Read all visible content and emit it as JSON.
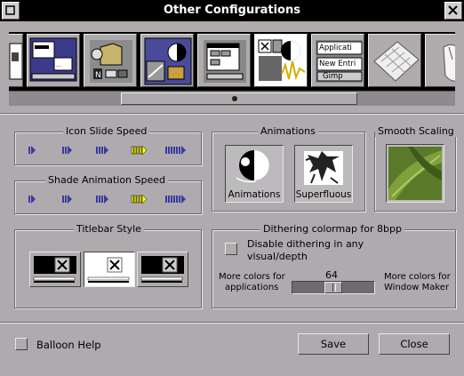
{
  "window": {
    "title": "Other Configurations"
  },
  "tabs": [
    {
      "id": "icon-prefs"
    },
    {
      "id": "workspace-prefs"
    },
    {
      "id": "misc-prefs"
    },
    {
      "id": "theme-prefs"
    },
    {
      "id": "window-handling"
    },
    {
      "id": "other-configurations",
      "selected": true
    },
    {
      "id": "application-prefs",
      "labels": [
        "Applicati",
        "New Entri",
        "Gimp"
      ]
    },
    {
      "id": "keyboard-prefs"
    },
    {
      "id": "mouse-prefs"
    }
  ],
  "icon_slide": {
    "title": "Icon Slide Speed",
    "levels": 5,
    "selected_index": 3
  },
  "shade_speed": {
    "title": "Shade Animation Speed",
    "levels": 5,
    "selected_index": 3
  },
  "animations": {
    "title": "Animations",
    "animations_label": "Animations",
    "superfluous_label": "Superfluous"
  },
  "smooth_scaling": {
    "title": "Smooth Scaling"
  },
  "titlebar_style": {
    "title": "Titlebar Style",
    "selected_index": 1
  },
  "dithering": {
    "title": "Dithering colormap for 8bpp",
    "checkbox_label_1": "Disable dithering in any",
    "checkbox_label_2": "visual/depth",
    "value": "64",
    "left_label_1": "More colors for",
    "left_label_2": "applications",
    "right_label_1": "More colors for",
    "right_label_2": "Window Maker",
    "slider_fraction": 0.5
  },
  "footer": {
    "balloon_help": "Balloon Help",
    "save": "Save",
    "close": "Close"
  },
  "colors": {
    "background": "#aeaaae",
    "titlebar": "#000000",
    "speed_selected": "#ffff00"
  }
}
